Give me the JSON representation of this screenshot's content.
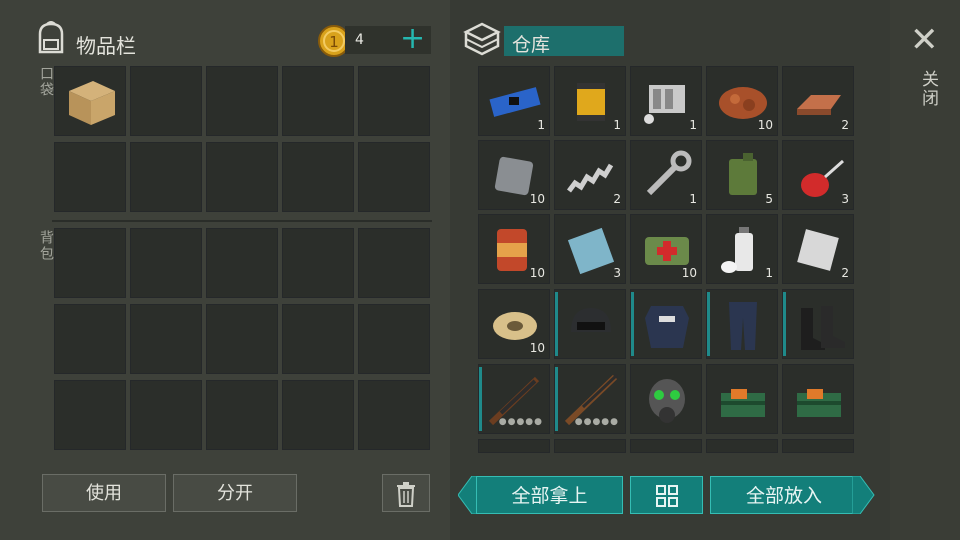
{
  "inventory": {
    "title": "物品栏",
    "pocket_label": "口袋",
    "backpack_label": "背包",
    "coins": "4",
    "add_glyph": "+"
  },
  "storage": {
    "title": "仓库"
  },
  "close": {
    "label": "关闭",
    "glyph": "✕"
  },
  "buttons": {
    "use": "使用",
    "split": "分开",
    "take_all": "全部拿上",
    "put_all": "全部放入"
  },
  "storage_items": [
    {
      "icon": "circuit-board-icon",
      "count": "1"
    },
    {
      "icon": "oil-filter-icon",
      "count": "1"
    },
    {
      "icon": "engine-block-icon",
      "count": "1"
    },
    {
      "icon": "copper-ore-icon",
      "count": "10"
    },
    {
      "icon": "copper-ingot-icon",
      "count": "2"
    },
    {
      "icon": "metal-plate-icon",
      "count": "10"
    },
    {
      "icon": "spring-icon",
      "count": "2"
    },
    {
      "icon": "wrench-icon",
      "count": "1"
    },
    {
      "icon": "jerry-can-icon",
      "count": "5"
    },
    {
      "icon": "oil-can-icon",
      "count": "3"
    },
    {
      "icon": "canned-food-icon",
      "count": "10"
    },
    {
      "icon": "glass-pane-icon",
      "count": "3"
    },
    {
      "icon": "medkit-bag-icon",
      "count": "10"
    },
    {
      "icon": "spray-paint-icon",
      "count": "1"
    },
    {
      "icon": "steel-sheet-icon",
      "count": "2"
    },
    {
      "icon": "wire-spool-icon",
      "count": "10"
    },
    {
      "icon": "helmet-icon",
      "count": ""
    },
    {
      "icon": "body-armor-icon",
      "count": ""
    },
    {
      "icon": "tactical-pants-icon",
      "count": ""
    },
    {
      "icon": "boots-icon",
      "count": ""
    },
    {
      "icon": "assault-rifle-icon",
      "count": ""
    },
    {
      "icon": "sniper-rifle-icon",
      "count": ""
    },
    {
      "icon": "gas-mask-icon",
      "count": ""
    },
    {
      "icon": "explosive-crate-icon",
      "count": ""
    },
    {
      "icon": "explosive-crate-icon",
      "count": ""
    }
  ],
  "colors": {
    "accent": "#137f7a",
    "coin": "#d9a21c"
  }
}
